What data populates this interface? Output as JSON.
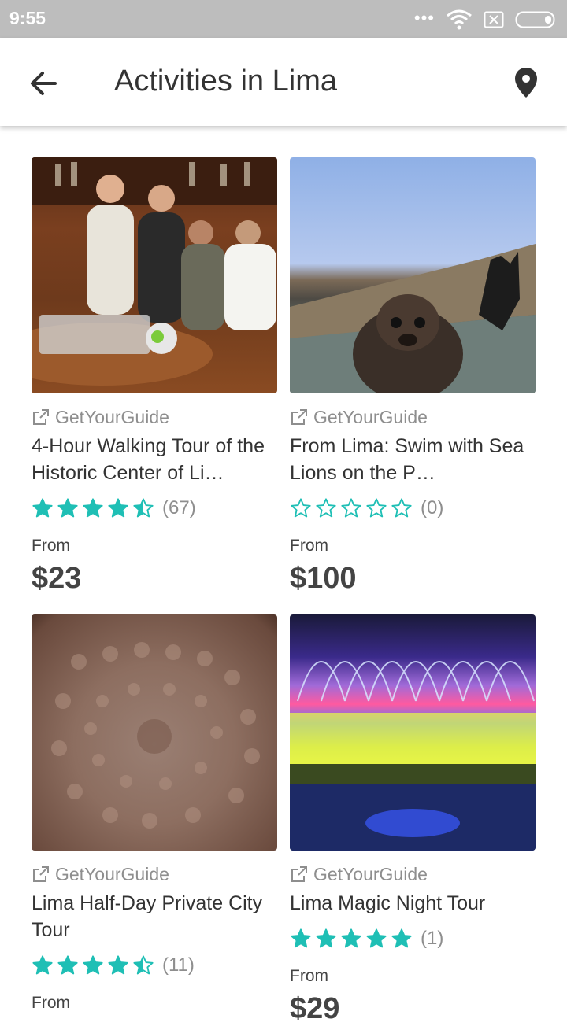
{
  "status_bar": {
    "time": "9:55",
    "dots": "•••"
  },
  "app_bar": {
    "title": "Activities in Lima"
  },
  "colors": {
    "star": "#1fbfb5",
    "status_bar_bg": "#bdbdbd"
  },
  "icons": {
    "back": "arrow-left-icon",
    "map": "map-pin-icon",
    "external": "external-link-icon",
    "star": "star-icon"
  },
  "cards": [
    {
      "provider": "GetYourGuide",
      "name": "4-Hour Walking Tour of the Historic Center of Li…",
      "rating": 4.5,
      "count": "(67)",
      "from": "From",
      "price": "$23"
    },
    {
      "provider": "GetYourGuide",
      "name": "From Lima: Swim with Sea Lions on the P…",
      "rating": 0,
      "count": "(0)",
      "from": "From",
      "price": "$100"
    },
    {
      "provider": "GetYourGuide",
      "name": "Lima Half-Day Private City Tour",
      "rating": 4.5,
      "count": "(11)",
      "from": "From",
      "price": ""
    },
    {
      "provider": "GetYourGuide",
      "name": "Lima Magic Night Tour",
      "rating": 5,
      "count": "(1)",
      "from": "From",
      "price": "$29"
    }
  ]
}
